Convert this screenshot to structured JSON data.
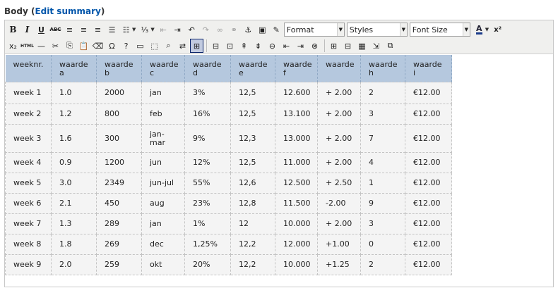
{
  "field": {
    "label": "Body",
    "open_paren": "(",
    "link_text": "Edit summary",
    "close_paren": ")"
  },
  "toolbar": {
    "row1": [
      {
        "name": "bold-button",
        "kind": "bold",
        "glyph": "B"
      },
      {
        "name": "italic-button",
        "kind": "italic",
        "glyph": "I"
      },
      {
        "name": "underline-button",
        "kind": "underline",
        "glyph": "U"
      },
      {
        "name": "strikethrough-button",
        "kind": "strike",
        "glyph": "ABC"
      },
      {
        "name": "align-left-button",
        "kind": "icon",
        "glyph": "≡"
      },
      {
        "name": "align-center-button",
        "kind": "icon",
        "glyph": "≡"
      },
      {
        "name": "align-right-button",
        "kind": "icon",
        "glyph": "≡"
      },
      {
        "name": "align-justify-button",
        "kind": "icon",
        "glyph": "☰"
      },
      {
        "name": "bullet-list-button",
        "kind": "icon",
        "glyph": "☷",
        "caret": true
      },
      {
        "name": "numbered-list-button",
        "kind": "icon",
        "glyph": "⅓",
        "caret": true
      },
      {
        "name": "outdent-button",
        "kind": "icon",
        "glyph": "⇤",
        "muted": true
      },
      {
        "name": "indent-button",
        "kind": "icon",
        "glyph": "⇥"
      },
      {
        "name": "undo-button",
        "kind": "icon",
        "glyph": "↶"
      },
      {
        "name": "redo-button",
        "kind": "icon",
        "glyph": "↷",
        "muted": true
      },
      {
        "name": "link-button",
        "kind": "icon",
        "glyph": "∞",
        "muted": true
      },
      {
        "name": "unlink-button",
        "kind": "icon",
        "glyph": "⚭",
        "muted": true
      },
      {
        "name": "anchor-button",
        "kind": "icon",
        "glyph": "⚓"
      },
      {
        "name": "image-button",
        "kind": "icon",
        "glyph": "▣"
      },
      {
        "name": "cleanup-button",
        "kind": "icon",
        "glyph": "✎"
      }
    ],
    "format_select": "Format",
    "styles_select": "Styles",
    "fontsize_select": "Font Size",
    "forecolor_glyph": "A",
    "superscript_glyph": "x²",
    "row2": [
      {
        "name": "subscript-button",
        "kind": "icon",
        "glyph": "x₂"
      },
      {
        "name": "html-source-button",
        "kind": "tiny",
        "glyph": "HTML"
      },
      {
        "name": "horizontal-rule-button",
        "kind": "icon",
        "glyph": "—"
      },
      {
        "name": "cut-button",
        "kind": "icon",
        "glyph": "✂"
      },
      {
        "name": "copy-button",
        "kind": "icon",
        "glyph": "⎘"
      },
      {
        "name": "paste-button",
        "kind": "icon",
        "glyph": "📋"
      },
      {
        "name": "remove-format-button",
        "kind": "icon",
        "glyph": "⌫"
      },
      {
        "name": "special-char-button",
        "kind": "icon",
        "glyph": "Ω"
      },
      {
        "name": "help-button",
        "kind": "icon",
        "glyph": "?"
      },
      {
        "name": "insert-field-button",
        "kind": "icon",
        "glyph": "▭"
      },
      {
        "name": "fullscreen-button",
        "kind": "icon",
        "glyph": "⬚"
      },
      {
        "name": "find-button",
        "kind": "icon",
        "glyph": "⌕"
      },
      {
        "name": "replace-button",
        "kind": "icon",
        "glyph": "⇄"
      },
      {
        "name": "visual-aid-button",
        "kind": "icon",
        "glyph": "⊞",
        "active": true
      },
      {
        "sep": true
      },
      {
        "name": "table-props-button",
        "kind": "icon",
        "glyph": "⊟"
      },
      {
        "name": "cell-props-button",
        "kind": "icon",
        "glyph": "⊡"
      },
      {
        "name": "row-before-button",
        "kind": "icon",
        "glyph": "⇞"
      },
      {
        "name": "row-after-button",
        "kind": "icon",
        "glyph": "⇟"
      },
      {
        "name": "delete-row-button",
        "kind": "icon",
        "glyph": "⊖"
      },
      {
        "name": "col-before-button",
        "kind": "icon",
        "glyph": "⇤"
      },
      {
        "name": "col-after-button",
        "kind": "icon",
        "glyph": "⇥"
      },
      {
        "name": "delete-col-button",
        "kind": "icon",
        "glyph": "⊗"
      },
      {
        "sep": true
      },
      {
        "name": "split-cells-button",
        "kind": "icon",
        "glyph": "⊞"
      },
      {
        "name": "merge-cells-button",
        "kind": "icon",
        "glyph": "⊟"
      },
      {
        "name": "insert-table-button",
        "kind": "icon",
        "glyph": "▦"
      },
      {
        "name": "page-break-button",
        "kind": "icon",
        "glyph": "⇲"
      },
      {
        "name": "insert-layer-button",
        "kind": "icon",
        "glyph": "⧉"
      }
    ]
  },
  "table": {
    "headers": [
      "weeknr.",
      "waarde\na",
      "waarde\nb",
      "waarde\nc",
      "waarde\nd",
      "waarde\ne",
      "waarde\nf",
      "waarde",
      "waarde\nh",
      "waarde\ni"
    ],
    "rows": [
      [
        "week 1",
        "1.0",
        "2000",
        "jan",
        "3%",
        "12,5",
        "12.600",
        "+ 2.00",
        "2",
        "€12.00"
      ],
      [
        "week 2",
        "1.2",
        "800",
        "feb",
        "16%",
        "12,5",
        "13.100",
        "+ 2.00",
        "3",
        "€12.00"
      ],
      [
        "week 3",
        "1.6",
        "300",
        "jan-mar",
        "9%",
        "12,3",
        "13.000",
        "+ 2.00",
        "7",
        "€12.00"
      ],
      [
        "week 4",
        "0.9",
        "1200",
        "jun",
        "12%",
        "12,5",
        "11.000",
        "+ 2.00",
        "4",
        "€12.00"
      ],
      [
        "week 5",
        "3.0",
        "2349",
        "jun-jul",
        "55%",
        "12,6",
        "12.500",
        "+ 2.50",
        "1",
        "€12.00"
      ],
      [
        "week 6",
        "2.1",
        "450",
        "aug",
        "23%",
        "12,8",
        "11.500",
        "-2.00",
        "9",
        "€12.00"
      ],
      [
        "week 7",
        "1.3",
        "289",
        "jan",
        "1%",
        "12",
        "10.000",
        "+ 2.00",
        "3",
        "€12.00"
      ],
      [
        "week 8",
        "1.8",
        "269",
        "dec",
        "1,25%",
        "12,2",
        "12.000",
        "+1.00",
        "0",
        "€12.00"
      ],
      [
        "week 9",
        "2.0",
        "259",
        "okt",
        "20%",
        "12,2",
        "10.000",
        "+1.25",
        "2",
        "€12.00"
      ]
    ]
  }
}
